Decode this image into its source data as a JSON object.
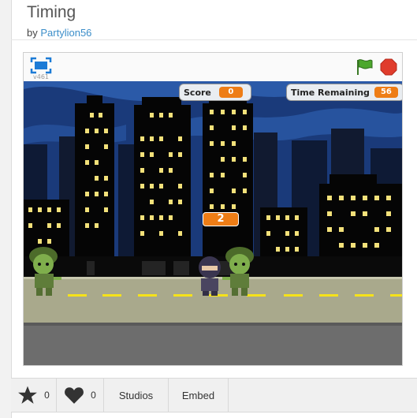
{
  "project": {
    "title": "Timing",
    "by_prefix": "by",
    "author": "Partylion56"
  },
  "player": {
    "version": "v461",
    "monitors": {
      "score_label": "Score",
      "score_value": "0",
      "time_label": "Time Remaining",
      "time_value": "56"
    },
    "floating_number": "2"
  },
  "actions": {
    "love_count": "0",
    "favorite_count": "0",
    "studios_label": "Studios",
    "embed_label": "Embed"
  },
  "colors": {
    "accent_orange": "#ee7d16",
    "link_blue": "#3c8ec9",
    "flag_green": "#4ca72c",
    "stop_red": "#e03c2c"
  }
}
